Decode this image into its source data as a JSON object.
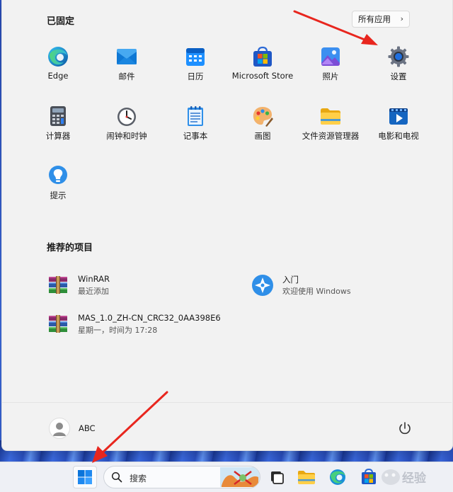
{
  "pinned": {
    "title": "已固定",
    "all_apps_label": "所有应用",
    "apps": [
      {
        "label": "Edge",
        "icon": "edge-icon"
      },
      {
        "label": "邮件",
        "icon": "mail-icon"
      },
      {
        "label": "日历",
        "icon": "calendar-icon"
      },
      {
        "label": "Microsoft Store",
        "icon": "store-icon"
      },
      {
        "label": "照片",
        "icon": "photos-icon"
      },
      {
        "label": "设置",
        "icon": "settings-icon"
      },
      {
        "label": "计算器",
        "icon": "calculator-icon"
      },
      {
        "label": "闹钟和时钟",
        "icon": "clock-icon"
      },
      {
        "label": "记事本",
        "icon": "notepad-icon"
      },
      {
        "label": "画图",
        "icon": "paint-icon"
      },
      {
        "label": "文件资源管理器",
        "icon": "folder-icon"
      },
      {
        "label": "电影和电视",
        "icon": "movies-icon"
      },
      {
        "label": "提示",
        "icon": "tips-icon"
      }
    ]
  },
  "recommended": {
    "title": "推荐的项目",
    "items": [
      {
        "name": "WinRAR",
        "sub": "最近添加",
        "icon": "winrar-icon"
      },
      {
        "name": "入门",
        "sub": "欢迎使用 Windows",
        "icon": "get-started-icon"
      },
      {
        "name": "MAS_1.0_ZH-CN_CRC32_0AA398E6",
        "sub": "星期一，时间为 17:28",
        "icon": "winrar-archive-icon"
      }
    ]
  },
  "user": {
    "name": "ABC"
  },
  "taskbar": {
    "search_label": "搜索"
  },
  "colors": {
    "accent": "#0067c0",
    "panel": "#f2f2f2",
    "arrow": "#e8261e"
  }
}
